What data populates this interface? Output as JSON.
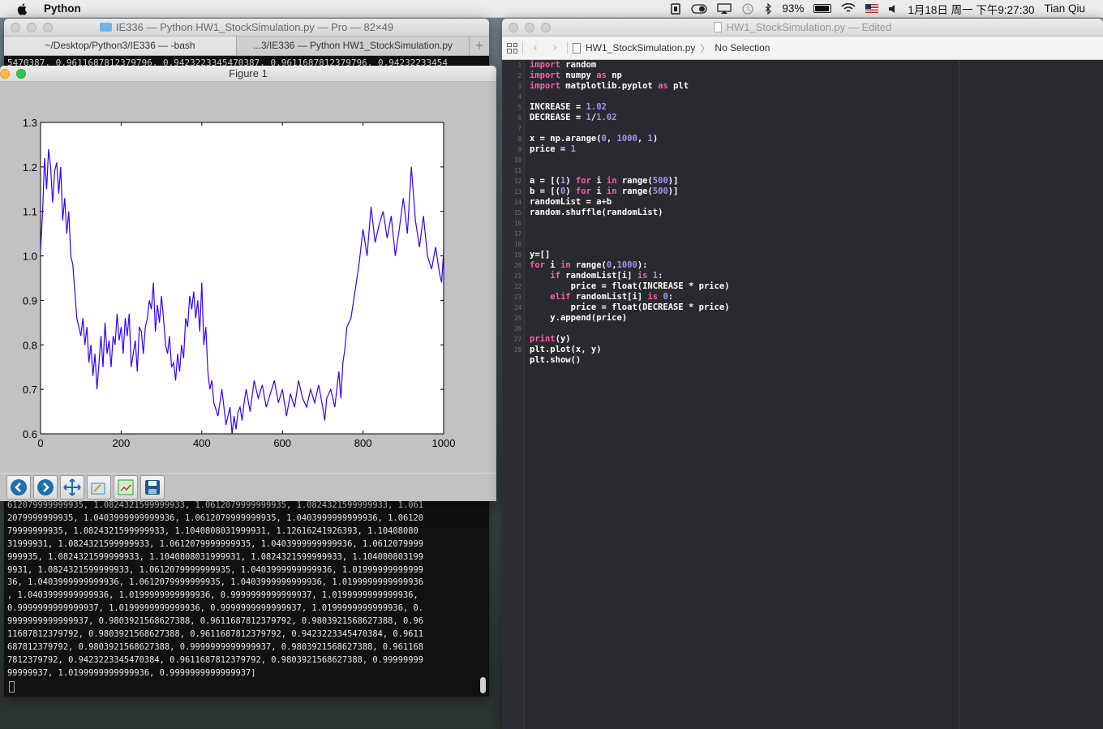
{
  "menubar": {
    "app_name": "Python",
    "battery": "93%",
    "battery_level": 0.93,
    "datetime": "1月18日 周一 下午9:27:30",
    "user": "Tian Qiu",
    "icons": [
      "apple-icon",
      "memory-icon",
      "toggle-icon",
      "airplay-icon",
      "time-machine-icon",
      "bluetooth-icon",
      "battery-icon",
      "wifi-icon",
      "us-flag-icon",
      "volume-icon"
    ]
  },
  "terminal": {
    "title": "IE336 — Python HW1_StockSimulation.py — Pro — 82×49",
    "tabs": [
      "~/Desktop/Python3/IE336 — -bash",
      "...3/IE336 — Python HW1_StockSimulation.py"
    ],
    "top_line": "5470387, 0.9611687812379796, 0.9423223345470387, 0.9611687812379796, 0.94232233454",
    "output": "612079999999935, 1.0824321599999933, 1.0612079999999935, 1.0824321599999933, 1.061\n2079999999935, 1.0403999999999936, 1.0612079999999935, 1.0403999999999936, 1.06120\n79999999935, 1.0824321599999933, 1.1040808031999931, 1.12616241926393, 1.10408080\n31999931, 1.0824321599999933, 1.0612079999999935, 1.0403999999999936, 1.0612079999\n999935, 1.0824321599999933, 1.1040808031999931, 1.0824321599999933, 1.104080803199\n9931, 1.0824321599999933, 1.0612079999999935, 1.0403999999999936, 1.01999999999999\n36, 1.0403999999999936, 1.0612079999999935, 1.0403999999999936, 1.0199999999999936\n, 1.0403999999999936, 1.0199999999999936, 0.9999999999999937, 1.0199999999999936,\n0.9999999999999937, 1.0199999999999936, 0.9999999999999937, 1.0199999999999936, 0.\n9999999999999937, 0.9803921568627388, 0.9611687812379792, 0.9803921568627388, 0.96\n11687812379792, 0.9803921568627388, 0.9611687812379792, 0.9423223345470384, 0.9611\n687812379792, 0.9803921568627388, 0.9999999999999937, 0.9803921568627388, 0.961168\n7812379792, 0.9423223345470384, 0.9611687812379792, 0.9803921568627388, 0.99999999\n99999937, 1.0199999999999936, 0.9999999999999937]"
  },
  "figure": {
    "title": "Figure 1",
    "toolbar": [
      "back-icon",
      "forward-icon",
      "pan-icon",
      "zoom-icon",
      "subplots-icon",
      "save-icon"
    ]
  },
  "chart_data": {
    "type": "line",
    "title": "",
    "xlabel": "",
    "ylabel": "",
    "xlim": [
      0,
      1000
    ],
    "ylim": [
      0.6,
      1.3
    ],
    "xticks": [
      0,
      200,
      400,
      600,
      800,
      1000
    ],
    "yticks": [
      0.6,
      0.7,
      0.8,
      0.9,
      1.0,
      1.1,
      1.2,
      1.3
    ],
    "ytick_labels": [
      "0.6",
      "0.7",
      "0.8",
      "0.9",
      "1.0",
      "1.1",
      "1.2",
      "1.3"
    ],
    "grid": false,
    "line_color": "#3300ff",
    "series": [
      {
        "x": [
          0,
          5,
          10,
          15,
          20,
          25,
          30,
          35,
          40,
          45,
          50,
          55,
          60,
          65,
          70,
          75,
          80,
          90,
          100,
          105,
          110,
          115,
          120,
          125,
          130,
          135,
          140,
          145,
          150,
          155,
          160,
          165,
          170,
          175,
          180,
          185,
          190,
          195,
          200,
          205,
          210,
          215,
          220,
          225,
          230,
          235,
          240,
          245,
          250,
          255,
          260,
          265,
          270,
          275,
          280,
          285,
          290,
          295,
          300,
          305,
          310,
          315,
          320,
          325,
          330,
          335,
          340,
          345,
          350,
          355,
          360,
          365,
          370,
          375,
          380,
          385,
          390,
          395,
          400,
          405,
          410,
          415,
          420,
          425,
          430,
          440,
          450,
          460,
          470,
          475,
          480,
          485,
          490,
          495,
          500,
          505,
          510,
          520,
          530,
          540,
          550,
          560,
          570,
          580,
          590,
          600,
          610,
          620,
          630,
          640,
          650,
          660,
          670,
          680,
          690,
          700,
          705,
          710,
          720,
          730,
          740,
          745,
          750,
          755,
          760,
          770,
          780,
          790,
          800,
          810,
          820,
          830,
          840,
          850,
          860,
          870,
          880,
          890,
          900,
          910,
          920,
          930,
          940,
          950,
          960,
          970,
          980,
          990,
          995,
          1000
        ],
        "y": [
          1.01,
          1.1,
          1.22,
          1.15,
          1.24,
          1.2,
          1.12,
          1.19,
          1.21,
          1.14,
          1.2,
          1.08,
          1.13,
          1.05,
          1.1,
          1.0,
          0.98,
          0.86,
          0.82,
          0.86,
          0.8,
          0.84,
          0.76,
          0.8,
          0.73,
          0.78,
          0.7,
          0.76,
          0.82,
          0.75,
          0.85,
          0.78,
          0.81,
          0.75,
          0.82,
          0.8,
          0.87,
          0.81,
          0.84,
          0.78,
          0.86,
          0.82,
          0.87,
          0.75,
          0.78,
          0.81,
          0.74,
          0.84,
          0.83,
          0.78,
          0.84,
          0.86,
          0.9,
          0.88,
          0.94,
          0.83,
          0.89,
          0.85,
          0.91,
          0.86,
          0.8,
          0.78,
          0.82,
          0.75,
          0.76,
          0.72,
          0.78,
          0.74,
          0.8,
          0.77,
          0.86,
          0.84,
          0.91,
          0.88,
          0.92,
          0.86,
          0.9,
          0.83,
          0.94,
          0.8,
          0.84,
          0.74,
          0.7,
          0.72,
          0.67,
          0.64,
          0.7,
          0.62,
          0.66,
          0.6,
          0.64,
          0.61,
          0.65,
          0.66,
          0.63,
          0.67,
          0.7,
          0.65,
          0.72,
          0.68,
          0.71,
          0.66,
          0.69,
          0.72,
          0.67,
          0.7,
          0.64,
          0.69,
          0.66,
          0.72,
          0.68,
          0.66,
          0.7,
          0.67,
          0.71,
          0.66,
          0.63,
          0.68,
          0.7,
          0.66,
          0.74,
          0.68,
          0.76,
          0.79,
          0.84,
          0.86,
          0.92,
          0.98,
          1.06,
          1.0,
          1.11,
          1.03,
          1.07,
          1.1,
          1.04,
          1.09,
          1.0,
          1.06,
          1.13,
          1.05,
          1.2,
          1.08,
          1.02,
          1.09,
          1.0,
          0.97,
          1.02,
          0.96,
          0.94,
          1.01
        ]
      }
    ]
  },
  "editor": {
    "title": "HW1_StockSimulation.py — Edited",
    "breadcrumb_file": "HW1_StockSimulation.py",
    "breadcrumb_selection": "No Selection",
    "code_lines": [
      "import random",
      "import numpy as np",
      "import matplotlib.pyplot as plt",
      "",
      "INCREASE = 1.02",
      "DECREASE = 1/1.02",
      "",
      "x = np.arange(0, 1000, 1)",
      "price = 1",
      "",
      "",
      "a = [(1) for i in range(500)]",
      "b = [(0) for i in range(500)]",
      "randomList = a+b",
      "random.shuffle(randomList)",
      "",
      "",
      "",
      "y=[]",
      "for i in range(0,1000):",
      "    if randomList[i] is 1:",
      "        price = float(INCREASE * price)",
      "    elif randomList[i] is 0:",
      "        price = float(DECREASE * price)",
      "    y.append(price)",
      "",
      "print(y)",
      "plt.plot(x, y)",
      "plt.show()"
    ],
    "line_numbers": [
      "1",
      "2",
      "3",
      "4",
      "5",
      "6",
      "7",
      "8",
      "9",
      "10",
      "11",
      "12",
      "13",
      "14",
      "15",
      "16",
      "17",
      "18",
      "19",
      "20",
      "21",
      "22",
      "23",
      "24",
      "25",
      "26",
      "27",
      "28"
    ]
  }
}
